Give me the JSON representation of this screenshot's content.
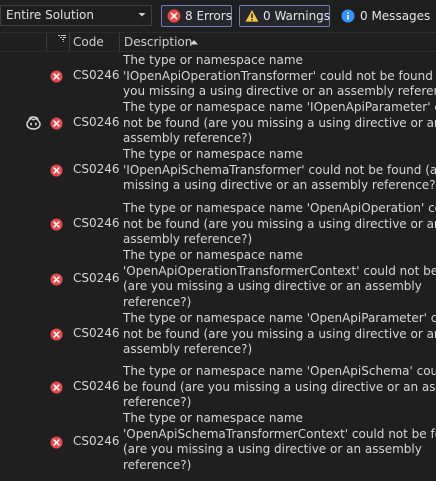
{
  "toolbar": {
    "scope": "Entire Solution",
    "errors_label": "8 Errors",
    "warnings_label": "0 Warnings",
    "messages_label": "0 Messages"
  },
  "columns": {
    "code": "Code",
    "description": "Description"
  },
  "rows": [
    {
      "code": "CS0246",
      "lines": [
        "The type or namespace name",
        "'IOpenApiOperationTransformer' could not be found (are",
        "you missing a using directive or an assembly reference?)"
      ]
    },
    {
      "code": "CS0246",
      "lines": [
        "The type or namespace name 'IOpenApiParameter' could",
        "not be found (are you missing a using directive or an",
        "assembly reference?)"
      ]
    },
    {
      "code": "CS0246",
      "lines": [
        "The type or namespace name",
        "'IOpenApiSchemaTransformer' could not be found (are you",
        "missing a using directive or an assembly reference?)"
      ]
    },
    {
      "code": "CS0246",
      "lines": [
        "The type or namespace name 'OpenApiOperation' could",
        "not be found (are you missing a using directive or an",
        "assembly reference?)"
      ]
    },
    {
      "code": "CS0246",
      "lines": [
        "The type or namespace name",
        "'OpenApiOperationTransformerContext' could not be found",
        "(are you missing a using directive or an assembly",
        "reference?)"
      ]
    },
    {
      "code": "CS0246",
      "lines": [
        "The type or namespace name 'OpenApiParameter' could",
        "not be found (are you missing a using directive or an",
        "assembly reference?)"
      ]
    },
    {
      "code": "CS0246",
      "lines": [
        "The type or namespace name 'OpenApiSchema' could not",
        "be found (are you missing a using directive or an assembly",
        "reference?)"
      ]
    },
    {
      "code": "CS0246",
      "lines": [
        "The type or namespace name",
        "'OpenApiSchemaTransformerContext' could not be found",
        "(are you missing a using directive or an assembly",
        "reference?)"
      ]
    }
  ],
  "icons": {
    "error": "error-circle-icon",
    "warning": "warning-triangle-icon",
    "message": "info-circle-icon",
    "copilot": "copilot-icon",
    "filter": "filter-icon",
    "sort": "sort-ascending-icon",
    "chevron": "chevron-down-icon"
  },
  "colors": {
    "error": "#e5484d",
    "warning": "#f2c94c",
    "info": "#3794ff",
    "accent_border": "#7a7ab5"
  }
}
